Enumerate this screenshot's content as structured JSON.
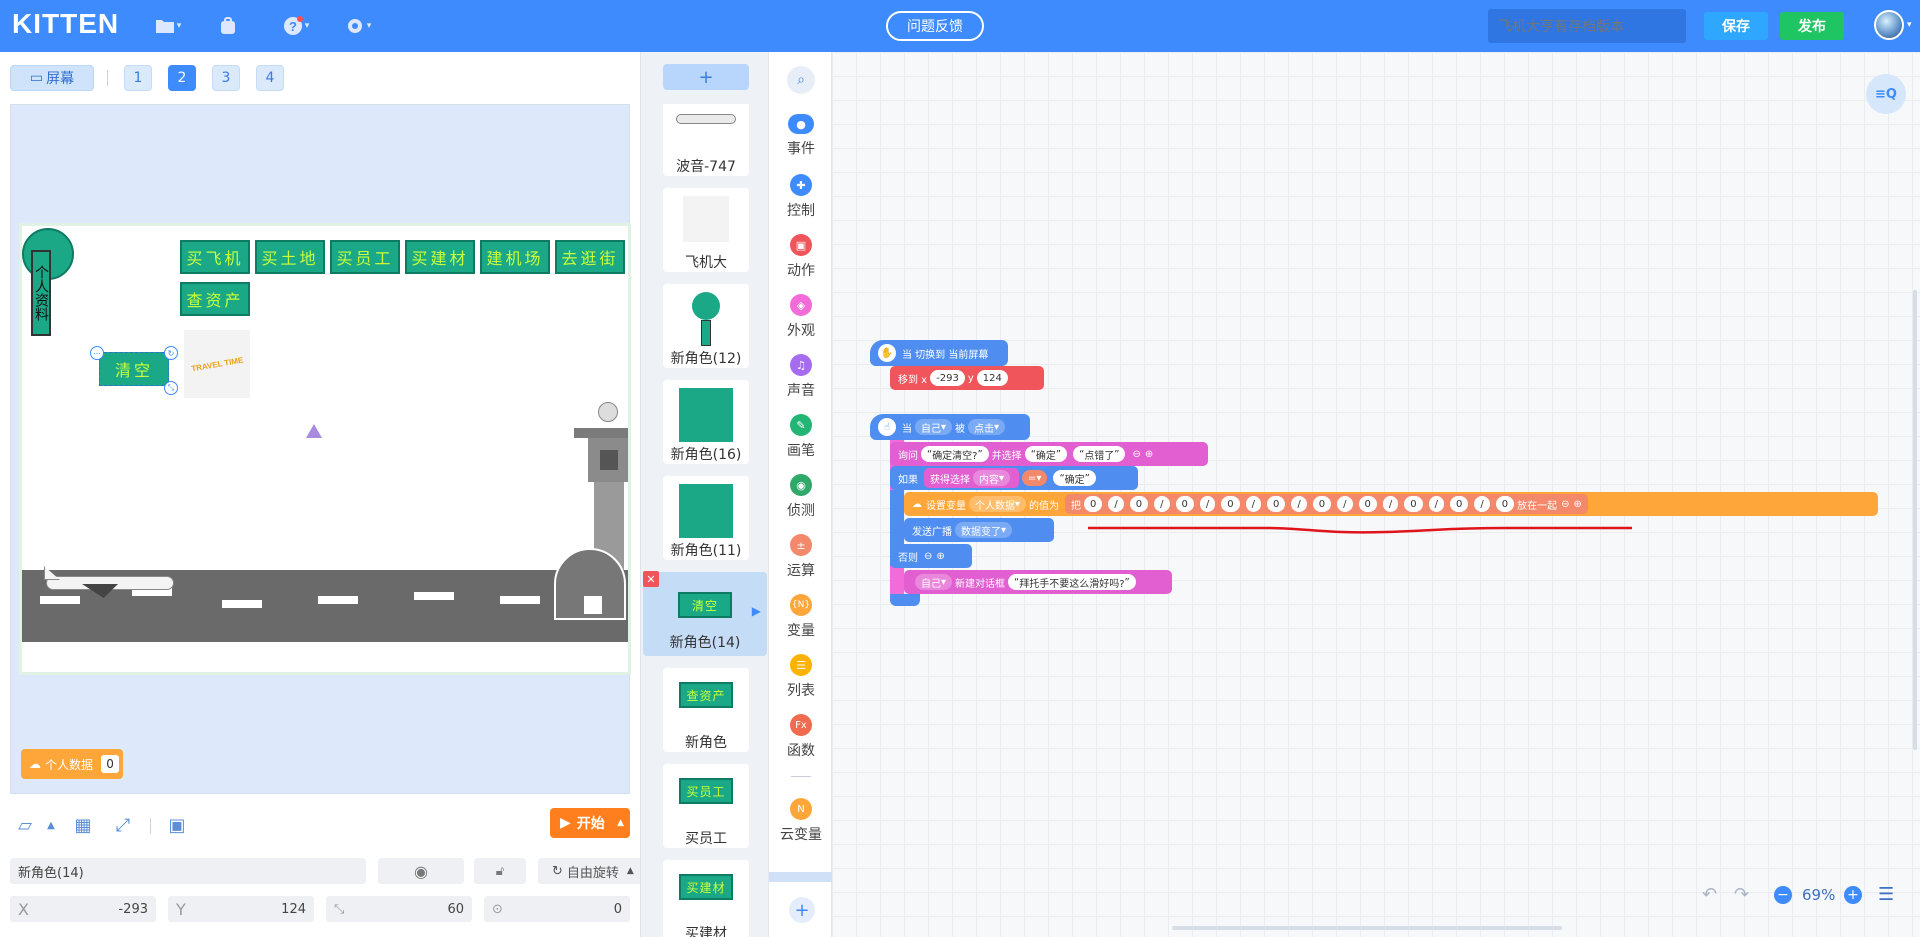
{
  "topbar": {
    "logo": "KITTEN",
    "feedback": "问题反馈",
    "search_placeholder": "飞机大亨有存档版本",
    "save": "保存",
    "publish": "发布"
  },
  "stage_panel": {
    "screen_button": "屏幕",
    "pages": [
      "1",
      "2",
      "3",
      "4"
    ],
    "active_page": "2",
    "buttons_row1": [
      "买飞机",
      "买土地",
      "买员工",
      "买建材",
      "建机场",
      "去逛街"
    ],
    "buttons_row2": [
      "查资产"
    ],
    "profile_label": "个人资料",
    "clear_label": "清空",
    "travel_label": "TRAVEL TIME",
    "var_monitor": {
      "name": "个人数据",
      "value": "0"
    },
    "start_button": "开始"
  },
  "properties": {
    "sprite_name": "新角色(14)",
    "rotation": "自由旋转",
    "x_label": "X",
    "x": "-293",
    "y_label": "Y",
    "y": "124",
    "size": "60",
    "direction": "0"
  },
  "sprites": [
    {
      "name": "波音-747"
    },
    {
      "name": "飞机大"
    },
    {
      "name": "新角色(12)"
    },
    {
      "name": "新角色(16)"
    },
    {
      "name": "新角色(11)"
    },
    {
      "name": "新角色(14)",
      "thumb": "清空"
    },
    {
      "name": "新角色",
      "thumb": "查资产"
    },
    {
      "name": "买员工",
      "thumb": "买员工"
    },
    {
      "name": "买建材",
      "thumb": "买建材"
    }
  ],
  "categories": [
    {
      "label": "事件",
      "color": "#3d8bfd"
    },
    {
      "label": "控制",
      "color": "#3d8bfd"
    },
    {
      "label": "动作",
      "color": "#f0555b"
    },
    {
      "label": "外观",
      "color": "#f26bd8"
    },
    {
      "label": "声音",
      "color": "#a66cf0"
    },
    {
      "label": "画笔",
      "color": "#22b573"
    },
    {
      "label": "侦测",
      "color": "#2fa86a"
    },
    {
      "label": "运算",
      "color": "#f3886a"
    },
    {
      "label": "变量",
      "color": "#ffa63a"
    },
    {
      "label": "列表",
      "color": "#ffb300"
    },
    {
      "label": "函数",
      "color": "#f06b4f"
    },
    {
      "label": "云变量",
      "color": "#ffa63a"
    }
  ],
  "blocks": {
    "when_switch": "当 切换到 当前屏幕",
    "move_x_label": "移到 x",
    "move_x": "-293",
    "move_y_label": "y",
    "move_y": "124",
    "when_label": "当",
    "self": "自己",
    "by_label": "被",
    "clicked": "点击",
    "ask_label": "询问",
    "ask_text": "确定清空?",
    "choose_label": "并选择",
    "opt1": "确定",
    "opt2": "点错了",
    "if_label": "如果",
    "get_choice": "获得选择",
    "content": "内容",
    "eq": "=",
    "confirm": "确定",
    "set_var": "设置变量",
    "var_name": "个人数据",
    "value_of": "的值为",
    "join_label": "把",
    "join_items": [
      "0",
      "/",
      "0",
      "/",
      "0",
      "/",
      "0",
      "/",
      "0",
      "/",
      "0",
      "/",
      "0",
      "/",
      "0",
      "/",
      "0",
      "/",
      "0"
    ],
    "join_end": "放在一起",
    "broadcast": "发送广播",
    "broadcast_msg": "数据变了",
    "else_label": "否则",
    "dialog_self": "自己",
    "dialog_label": "新建对话框",
    "dialog_text": "拜托手不要这么滑好吗?"
  },
  "zoom": "69%"
}
